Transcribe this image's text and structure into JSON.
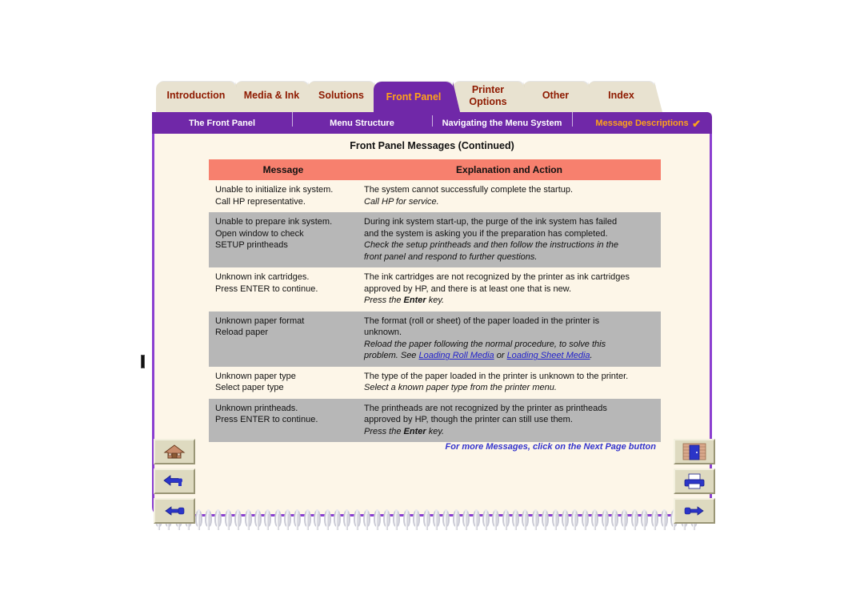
{
  "tabs": [
    {
      "label": "Introduction",
      "active": false,
      "two_line": false
    },
    {
      "label": "Media & Ink",
      "active": false,
      "two_line": false
    },
    {
      "label": "Solutions",
      "active": false,
      "two_line": false
    },
    {
      "label": "Front Panel",
      "active": true,
      "two_line": false
    },
    {
      "label": "Printer\nOptions",
      "active": false,
      "two_line": true
    },
    {
      "label": "Other",
      "active": false,
      "two_line": false
    },
    {
      "label": "Index",
      "active": false,
      "two_line": false
    }
  ],
  "subnav": {
    "items": [
      {
        "label": "The Front Panel",
        "current": false
      },
      {
        "label": "Menu Structure",
        "current": false
      },
      {
        "label": "Navigating the Menu System",
        "current": false
      },
      {
        "label": "Message Descriptions",
        "current": true
      }
    ],
    "check_glyph": "✔"
  },
  "page": {
    "title": "Front Panel Messages (Continued)",
    "footnote": "For more Messages, click on the Next Page button"
  },
  "table": {
    "headers": [
      "Message",
      "Explanation and Action"
    ],
    "rows": [
      {
        "shade": "odd",
        "message": [
          "Unable to initialize ink system.",
          "Call HP representative."
        ],
        "explanation": [
          {
            "text": "The system cannot successfully complete the startup.",
            "italic": false
          },
          {
            "text": "Call HP for service.",
            "italic": true
          }
        ]
      },
      {
        "shade": "even",
        "message": [
          "Unable to prepare ink system.",
          "Open window to check",
          "SETUP printheads"
        ],
        "explanation": [
          {
            "text": "During ink system start-up, the purge of the ink system has failed",
            "italic": false
          },
          {
            "text": "and the system is asking you if the preparation has completed.",
            "italic": false
          },
          {
            "text": "Check the setup printheads and then follow the instructions in the",
            "italic": true
          },
          {
            "text": "front panel and respond to further questions.",
            "italic": true
          }
        ]
      },
      {
        "shade": "odd",
        "message": [
          "Unknown ink cartridges.",
          "Press ENTER to continue."
        ],
        "explanation": [
          {
            "text": "The ink cartridges are not recognized by the printer as ink cartridges",
            "italic": false
          },
          {
            "text": "approved by HP, and there is at least one that is new.",
            "italic": false
          },
          {
            "text": "Press the Enter key.",
            "italic": true,
            "bold_word": "Enter"
          }
        ]
      },
      {
        "shade": "even",
        "message": [
          "Unknown paper format",
          "Reload paper"
        ],
        "explanation": [
          {
            "text": "The format (roll or sheet) of the paper loaded in the printer is",
            "italic": false
          },
          {
            "text": "unknown.",
            "italic": false
          },
          {
            "text": "Reload the paper following the normal procedure, to solve this",
            "italic": true
          },
          {
            "text": "problem. See Loading Roll Media or Loading Sheet Media.",
            "italic": true,
            "links": [
              "Loading Roll Media",
              "Loading Sheet Media"
            ]
          }
        ]
      },
      {
        "shade": "odd",
        "message": [
          "Unknown paper type",
          "Select paper type"
        ],
        "explanation": [
          {
            "text": "The type of the paper loaded in the printer is unknown to the printer.",
            "italic": false
          },
          {
            "text": "Select a known paper type from the printer menu.",
            "italic": true
          }
        ]
      },
      {
        "shade": "even",
        "message": [
          "Unknown printheads.",
          "Press ENTER to continue."
        ],
        "explanation": [
          {
            "text": "The printheads are not recognized by the printer as printheads",
            "italic": false
          },
          {
            "text": "approved by HP, though the printer can still use them.",
            "italic": false
          },
          {
            "text": "Press the Enter key.",
            "italic": true,
            "bold_word": "Enter"
          }
        ]
      }
    ]
  },
  "buttons": {
    "left": [
      {
        "icon": "home-icon"
      },
      {
        "icon": "back-arrow-icon"
      },
      {
        "icon": "hand-pointing-left-icon"
      }
    ],
    "right": [
      {
        "icon": "exit-door-icon"
      },
      {
        "icon": "printer-icon"
      },
      {
        "icon": "hand-pointing-right-icon"
      }
    ]
  },
  "colors": {
    "purple": "#7028A8",
    "purple_border": "#8B3FD0",
    "tab_cream": "#E8E2D0",
    "tab_text": "#8E1A00",
    "active_tab_text": "#FFA319",
    "paper": "#FDF6E8",
    "table_header": "#F7806E",
    "row_shade": "#B7B7B7",
    "link": "#2222CC",
    "footnote": "#3333CC"
  }
}
